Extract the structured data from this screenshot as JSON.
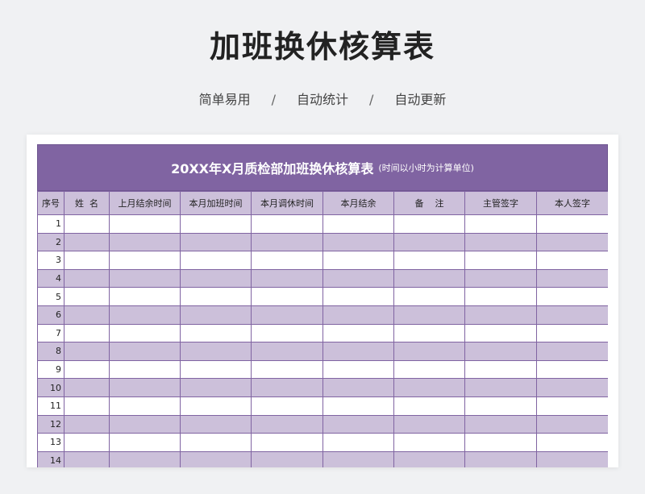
{
  "page": {
    "title": "加班换休核算表",
    "subtitle": [
      "简单易用",
      "自动统计",
      "自动更新"
    ],
    "separator": "/"
  },
  "sheet": {
    "title": "20XX年X月质检部加班换休核算表",
    "note": "(时间以小时为计算单位)",
    "columns": [
      "序号",
      "姓  名",
      "上月结余时间",
      "本月加班时间",
      "本月调休时间",
      "本月结余",
      "备    注",
      "主管签字",
      "本人签字"
    ],
    "rows": [
      "1",
      "2",
      "3",
      "4",
      "5",
      "6",
      "7",
      "8",
      "9",
      "10",
      "11",
      "12",
      "13",
      "14"
    ],
    "colors": {
      "header_bg": "#8064a2",
      "band_bg": "#ccc0da",
      "border": "#8064a2"
    }
  }
}
